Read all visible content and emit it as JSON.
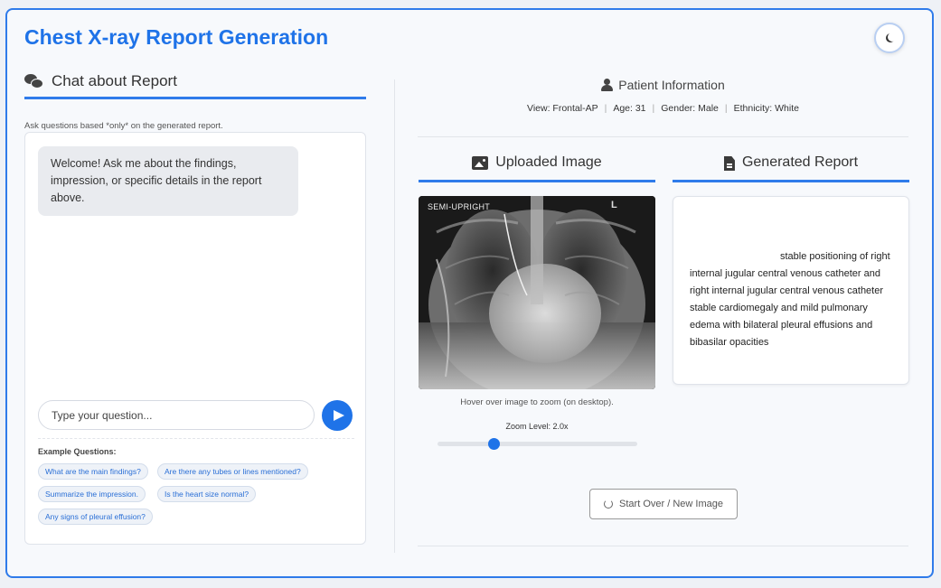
{
  "app": {
    "title": "Chest X-ray Report Generation"
  },
  "theme_toggle": {
    "icon": "moon-icon"
  },
  "chat": {
    "heading": "Chat about Report",
    "hint": "Ask questions based *only* on the generated report.",
    "welcome": "Welcome! Ask me about the findings, impression, or specific details in the report above.",
    "input_placeholder": "Type your question...",
    "send_icon": "send-arrow-icon",
    "examples_title": "Example Questions:",
    "examples": [
      "What are the main findings?",
      "Are there any tubes or lines mentioned?",
      "Summarize the impression.",
      "Is the heart size normal?",
      "Any signs of pleural effusion?"
    ]
  },
  "patient": {
    "heading": "Patient Information",
    "view": "View: Frontal-AP",
    "age": "Age: 31",
    "gender": "Gender: Male",
    "ethnicity": "Ethnicity: White"
  },
  "image_section": {
    "heading": "Uploaded Image",
    "overlay_label": "SEMI-UPRIGHT",
    "marker": "L",
    "zoom_hint": "Hover over image to zoom (on desktop).",
    "zoom_label": "Zoom Level: 2.0x",
    "zoom_value": 2.0,
    "zoom_fraction": 0.27
  },
  "report_section": {
    "heading": "Generated Report",
    "text": "stable positioning of right internal jugular central venous catheter and right internal jugular central venous catheter stable cardiomegaly and mild pulmonary edema with bilateral pleural effusions and bibasilar opacities"
  },
  "actions": {
    "start_over": "Start Over / New Image"
  },
  "colors": {
    "accent": "#1f73e8",
    "border": "#2f7bea"
  }
}
